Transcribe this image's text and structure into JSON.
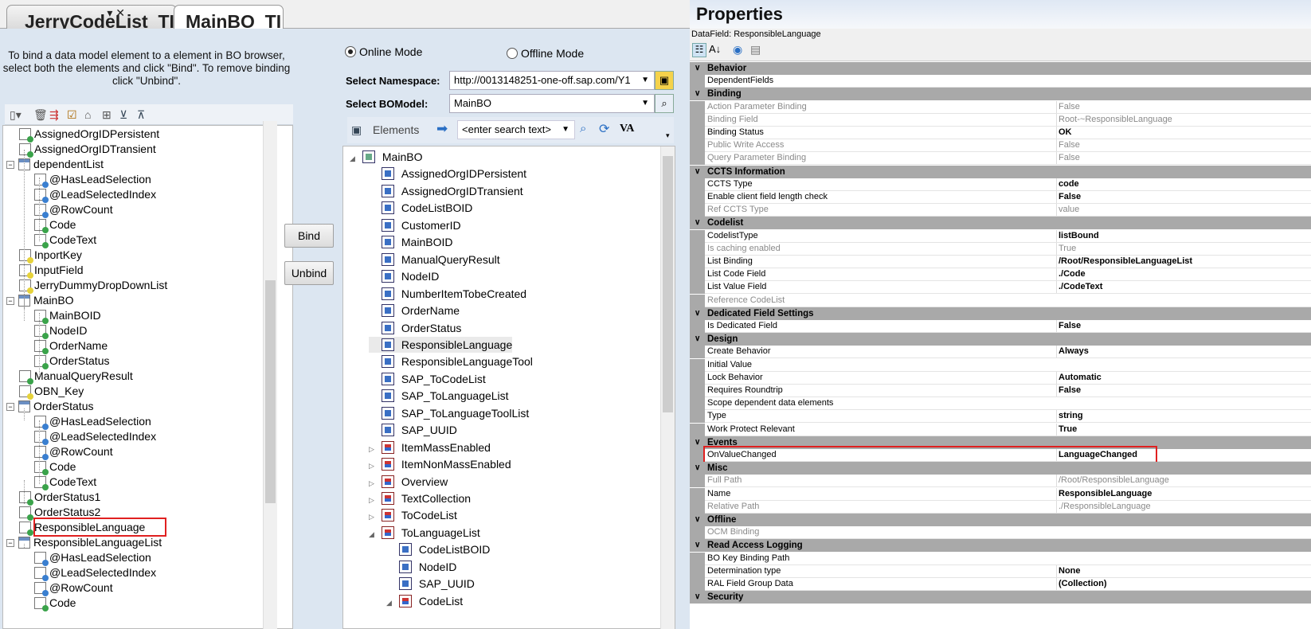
{
  "tabs": [
    {
      "label": "JerryCodeList_TI"
    },
    {
      "label": "MainBO_TI"
    }
  ],
  "tab_controls": "▾ ✕",
  "hint": "To bind a data model element to a element in BO browser, select both the elements and click \"Bind\". To remove binding click \"Unbind\".",
  "buttons": {
    "bind": "Bind",
    "unbind": "Unbind"
  },
  "mode": {
    "online": "Online Mode",
    "offline": "Offline Mode"
  },
  "namespace": {
    "label": "Select Namespace:",
    "value": "http://0013148251-one-off.sap.com/Y1"
  },
  "bomodel": {
    "label": "Select BOModel:",
    "value": "MainBO"
  },
  "bobar": {
    "elements": "Elements",
    "search_placeholder": "<enter search text>",
    "va": "VA"
  },
  "datamodel_tree": [
    {
      "label": "AssignedOrgIDPersistent",
      "icon": "fld",
      "level": 1
    },
    {
      "label": "AssignedOrgIDTransient",
      "icon": "fld",
      "level": 1
    },
    {
      "label": "dependentList",
      "icon": "lst",
      "level": 1,
      "toggle": "−"
    },
    {
      "label": "@HasLeadSelection",
      "icon": "blu",
      "level": 2
    },
    {
      "label": "@LeadSelectedIndex",
      "icon": "blu",
      "level": 2
    },
    {
      "label": "@RowCount",
      "icon": "blu",
      "level": 2
    },
    {
      "label": "Code",
      "icon": "fld",
      "level": 2
    },
    {
      "label": "CodeText",
      "icon": "fld",
      "level": 2
    },
    {
      "label": "InportKey",
      "icon": "yel",
      "level": 1
    },
    {
      "label": "InputField",
      "icon": "yel",
      "level": 1
    },
    {
      "label": "JerryDummyDropDownList",
      "icon": "yel",
      "level": 1
    },
    {
      "label": "MainBO",
      "icon": "lst",
      "level": 1,
      "toggle": "−"
    },
    {
      "label": "MainBOID",
      "icon": "fld",
      "level": 2
    },
    {
      "label": "NodeID",
      "icon": "fld",
      "level": 2
    },
    {
      "label": "OrderName",
      "icon": "fld",
      "level": 2
    },
    {
      "label": "OrderStatus",
      "icon": "fld",
      "level": 2
    },
    {
      "label": "ManualQueryResult",
      "icon": "fld",
      "level": 1
    },
    {
      "label": "OBN_Key",
      "icon": "yel",
      "level": 1
    },
    {
      "label": "OrderStatus",
      "icon": "lst",
      "level": 1,
      "toggle": "−"
    },
    {
      "label": "@HasLeadSelection",
      "icon": "blu",
      "level": 2
    },
    {
      "label": "@LeadSelectedIndex",
      "icon": "blu",
      "level": 2
    },
    {
      "label": "@RowCount",
      "icon": "blu",
      "level": 2
    },
    {
      "label": "Code",
      "icon": "fld",
      "level": 2
    },
    {
      "label": "CodeText",
      "icon": "fld",
      "level": 2
    },
    {
      "label": "OrderStatus1",
      "icon": "fld",
      "level": 1
    },
    {
      "label": "OrderStatus2",
      "icon": "fld",
      "level": 1
    },
    {
      "label": "ResponsibleLanguage",
      "icon": "fld",
      "level": 1,
      "highlight": true
    },
    {
      "label": "ResponsibleLanguageList",
      "icon": "lst",
      "level": 1,
      "toggle": "−"
    },
    {
      "label": "@HasLeadSelection",
      "icon": "blu",
      "level": 2
    },
    {
      "label": "@LeadSelectedIndex",
      "icon": "blu",
      "level": 2
    },
    {
      "label": "@RowCount",
      "icon": "blu",
      "level": 2
    },
    {
      "label": "Code",
      "icon": "fld",
      "level": 2
    }
  ],
  "bo_tree": [
    {
      "label": "MainBO",
      "kind": "root",
      "level": 0,
      "toggle": "◢"
    },
    {
      "label": "AssignedOrgIDPersistent",
      "kind": "elem",
      "level": 1
    },
    {
      "label": "AssignedOrgIDTransient",
      "kind": "elem",
      "level": 1
    },
    {
      "label": "CodeListBOID",
      "kind": "elem",
      "level": 1
    },
    {
      "label": "CustomerID",
      "kind": "elem",
      "level": 1
    },
    {
      "label": "MainBOID",
      "kind": "elem",
      "level": 1
    },
    {
      "label": "ManualQueryResult",
      "kind": "elem",
      "level": 1
    },
    {
      "label": "NodeID",
      "kind": "elem",
      "level": 1
    },
    {
      "label": "NumberItemTobeCreated",
      "kind": "elem",
      "level": 1
    },
    {
      "label": "OrderName",
      "kind": "elem",
      "level": 1
    },
    {
      "label": "OrderStatus",
      "kind": "elem",
      "level": 1
    },
    {
      "label": "ResponsibleLanguage",
      "kind": "elem",
      "level": 1,
      "selected": true
    },
    {
      "label": "ResponsibleLanguageTool",
      "kind": "elem",
      "level": 1
    },
    {
      "label": "SAP_ToCodeList",
      "kind": "elem",
      "level": 1
    },
    {
      "label": "SAP_ToLanguageList",
      "kind": "elem",
      "level": 1
    },
    {
      "label": "SAP_ToLanguageToolList",
      "kind": "elem",
      "level": 1
    },
    {
      "label": "SAP_UUID",
      "kind": "elem",
      "level": 1
    },
    {
      "label": "ItemMassEnabled",
      "kind": "node",
      "level": 1,
      "toggle": "▷"
    },
    {
      "label": "ItemNonMassEnabled",
      "kind": "node",
      "level": 1,
      "toggle": "▷"
    },
    {
      "label": "Overview",
      "kind": "node",
      "level": 1,
      "toggle": "▷"
    },
    {
      "label": "TextCollection",
      "kind": "node",
      "level": 1,
      "toggle": "▷"
    },
    {
      "label": "ToCodeList",
      "kind": "node",
      "level": 1,
      "toggle": "▷"
    },
    {
      "label": "ToLanguageList",
      "kind": "node",
      "level": 1,
      "toggle": "◢"
    },
    {
      "label": "CodeListBOID",
      "kind": "elem",
      "level": 2
    },
    {
      "label": "NodeID",
      "kind": "elem",
      "level": 2
    },
    {
      "label": "SAP_UUID",
      "kind": "elem",
      "level": 2
    },
    {
      "label": "CodeList",
      "kind": "node",
      "level": 2,
      "toggle": "◢"
    }
  ],
  "properties": {
    "title": "Properties",
    "subtitle": "DataField: ResponsibleLanguage",
    "groups": [
      {
        "name": "Behavior",
        "rows": [
          [
            "DependentFields",
            "",
            false
          ]
        ]
      },
      {
        "name": "Binding",
        "rows": [
          [
            "Action Parameter Binding",
            "False",
            true
          ],
          [
            "Binding Field",
            "Root-~ResponsibleLanguage",
            true
          ],
          [
            "Binding Status",
            "OK",
            false
          ],
          [
            "Public Write Access",
            "False",
            true
          ],
          [
            "Query Parameter Binding",
            "False",
            true
          ]
        ]
      },
      {
        "name": "CCTS Information",
        "rows": [
          [
            "CCTS Type",
            "code",
            false
          ],
          [
            "Enable client field length check",
            "False",
            false
          ],
          [
            "Ref CCTS Type",
            "value",
            true
          ]
        ]
      },
      {
        "name": "Codelist",
        "rows": [
          [
            "CodelistType",
            "listBound",
            false
          ],
          [
            "Is caching enabled",
            "True",
            true
          ],
          [
            "List Binding",
            "/Root/ResponsibleLanguageList",
            false
          ],
          [
            "List Code Field",
            "./Code",
            false
          ],
          [
            "List Value Field",
            "./CodeText",
            false
          ],
          [
            "Reference CodeList",
            "",
            true
          ]
        ]
      },
      {
        "name": "Dedicated Field Settings",
        "rows": [
          [
            "Is Dedicated Field",
            "False",
            false
          ]
        ]
      },
      {
        "name": "Design",
        "rows": [
          [
            "Create Behavior",
            "Always",
            false
          ],
          [
            "Initial Value",
            "",
            false
          ],
          [
            "Lock Behavior",
            "Automatic",
            false
          ],
          [
            "Requires Roundtrip",
            "False",
            false
          ],
          [
            "Scope dependent data elements",
            "",
            false
          ],
          [
            "Type",
            "string",
            false
          ],
          [
            "Work Protect Relevant",
            "True",
            false
          ]
        ]
      },
      {
        "name": "Events",
        "rows": [
          [
            "OnValueChanged",
            "LanguageChanged",
            false
          ]
        ]
      },
      {
        "name": "Misc",
        "rows": [
          [
            "Full Path",
            "/Root/ResponsibleLanguage",
            true
          ],
          [
            "Name",
            "ResponsibleLanguage",
            false
          ],
          [
            "Relative Path",
            "./ResponsibleLanguage",
            true
          ]
        ]
      },
      {
        "name": "Offline",
        "rows": [
          [
            "OCM Binding",
            "",
            true
          ]
        ]
      },
      {
        "name": "Read Access Logging",
        "rows": [
          [
            "BO Key Binding Path",
            "",
            false
          ],
          [
            "Determination type",
            "None",
            false
          ],
          [
            "RAL Field Group Data",
            "(Collection)",
            false
          ]
        ]
      },
      {
        "name": "Security",
        "rows": []
      }
    ]
  },
  "colors": {
    "highlight": "#e02020",
    "panel_bg": "#dce6f1",
    "category_bg": "#a9a9a9"
  }
}
